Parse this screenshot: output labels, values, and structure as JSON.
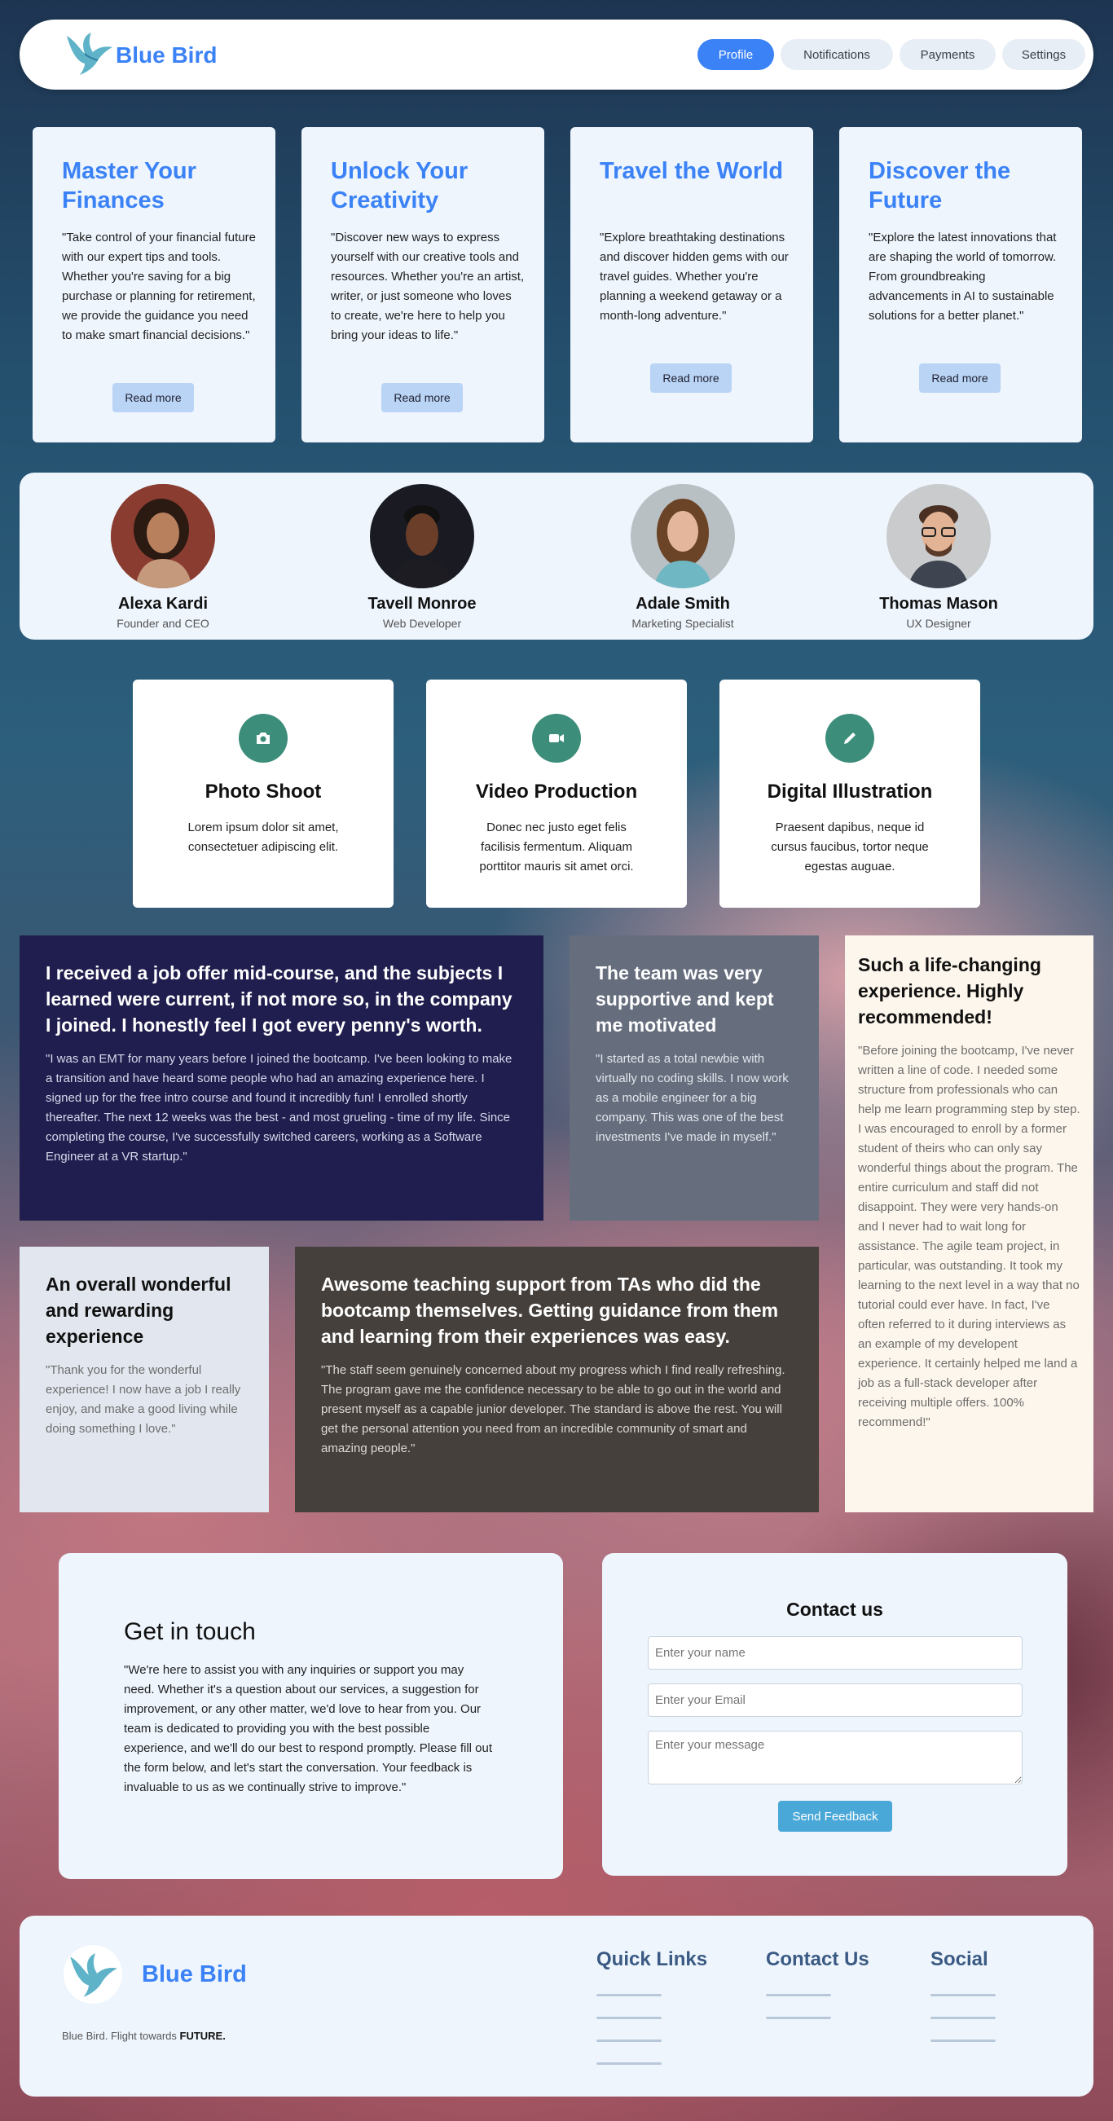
{
  "brand": {
    "name": "Blue Bird"
  },
  "nav": {
    "items": [
      "Profile",
      "Notifications",
      "Payments",
      "Settings"
    ],
    "active": "Profile"
  },
  "feature_cards": [
    {
      "title": "Master Your Finances",
      "text": "\"Take control of your financial future with our expert tips and tools. Whether you're saving for a big purchase or planning for retirement, we provide the guidance you need to make smart financial decisions.\"",
      "button": "Read more"
    },
    {
      "title": "Unlock Your Creativity",
      "text": "\"Discover new ways to express yourself with our creative tools and resources. Whether you're an artist, writer, or just someone who loves to create, we're here to help you bring your ideas to life.\"",
      "button": "Read more"
    },
    {
      "title": "Travel the World",
      "text": "\"Explore breathtaking destinations and discover hidden gems with our travel guides. Whether you're planning a weekend getaway or a month-long adventure.\"",
      "button": "Read more"
    },
    {
      "title": "Discover the Future",
      "text": "\"Explore the latest innovations that are shaping the world of tomorrow. From groundbreaking advancements in AI to sustainable solutions for a better planet.\"",
      "button": "Read more"
    }
  ],
  "team": [
    {
      "name": "Alexa Kardi",
      "role": "Founder and CEO"
    },
    {
      "name": "Tavell Monroe",
      "role": "Web Developer"
    },
    {
      "name": "Adale Smith",
      "role": "Marketing Specialist"
    },
    {
      "name": "Thomas Mason",
      "role": "UX Designer"
    }
  ],
  "services": [
    {
      "icon": "camera-icon",
      "title": "Photo Shoot",
      "text": "Lorem ipsum dolor sit amet, consectetuer adipiscing elit."
    },
    {
      "icon": "video-camera-icon",
      "title": "Video Production",
      "text": "Donec nec justo eget felis facilisis fermentum. Aliquam porttitor mauris sit amet orci."
    },
    {
      "icon": "pencil-icon",
      "title": "Digital Illustration",
      "text": "Praesent dapibus, neque id cursus faucibus, tortor neque egestas auguae."
    }
  ],
  "testimonials": [
    {
      "title": "I received a job offer mid-course, and the subjects I learned were current, if not more so, in the company I joined. I honestly feel I got every penny's worth.",
      "text": "\"I was an EMT for many years before I joined the bootcamp. I've been looking to make a transition and have heard some people who had an amazing experience here. I signed up for the free intro course and found it incredibly fun! I enrolled shortly thereafter. The next 12 weeks was the best - and most grueling - time of my life. Since completing the course, I've successfully switched careers, working as a Software Engineer at a VR startup.\""
    },
    {
      "title": "The team was very supportive and kept me motivated",
      "text": "\"I started as a total newbie with virtually no coding skills. I now work as a mobile engineer for a big company. This was one of the best investments I've made in myself.\""
    },
    {
      "title": "Such a life-changing experience. Highly recommended!",
      "text": "\"Before joining the bootcamp, I've never written a line of code. I needed some structure from professionals who can help me learn programming step by step. I was encouraged to enroll by a former student of theirs who can only say wonderful things about the program. The entire curriculum and staff did not disappoint. They were very hands-on and I never had to wait long for assistance. The agile team project, in particular, was outstanding. It took my learning to the next level in a way that no tutorial could ever have. In fact, I've often referred to it during interviews as an example of my developent experience. It certainly helped me land a job as a full-stack developer after receiving multiple offers. 100% recommend!\""
    },
    {
      "title": "An overall wonderful and rewarding experience",
      "text": "\"Thank you for the wonderful experience! I now have a job I really enjoy, and make a good living while doing something I love.\""
    },
    {
      "title": "Awesome teaching support from TAs who did the bootcamp themselves. Getting guidance from them and learning from their experiences was easy.",
      "text": "\"The staff seem genuinely concerned about my progress which I find really refreshing. The program gave me the confidence necessary to be able to go out in the world and present myself as a capable junior developer. The standard is above the rest. You will get the personal attention you need from an incredible community of smart and amazing people.\""
    }
  ],
  "get_in_touch": {
    "title": "Get in touch",
    "text": "\"We're here to assist you with any inquiries or support you may need. Whether it's a question about our services, a suggestion for improvement, or any other matter, we'd love to hear from you. Our team is dedicated to providing you with the best possible experience, and we'll do our best to respond promptly. Please fill out the form below, and let's start the conversation. Your feedback is invaluable to us as we continually strive to improve.\""
  },
  "contact_form": {
    "title": "Contact us",
    "name_placeholder": "Enter your name",
    "email_placeholder": "Enter your Email",
    "message_placeholder": "Enter your message",
    "submit": "Send Feedback"
  },
  "footer": {
    "brand": "Blue Bird",
    "tagline": "Blue Bird. Flight towards ",
    "tagline_bold": "FUTURE.",
    "columns": [
      "Quick Links",
      "Contact Us",
      "Social"
    ]
  },
  "colors": {
    "accent": "#3b82f6",
    "icon_bg": "#3c8d7a",
    "button_teal": "#4aa8d8"
  }
}
